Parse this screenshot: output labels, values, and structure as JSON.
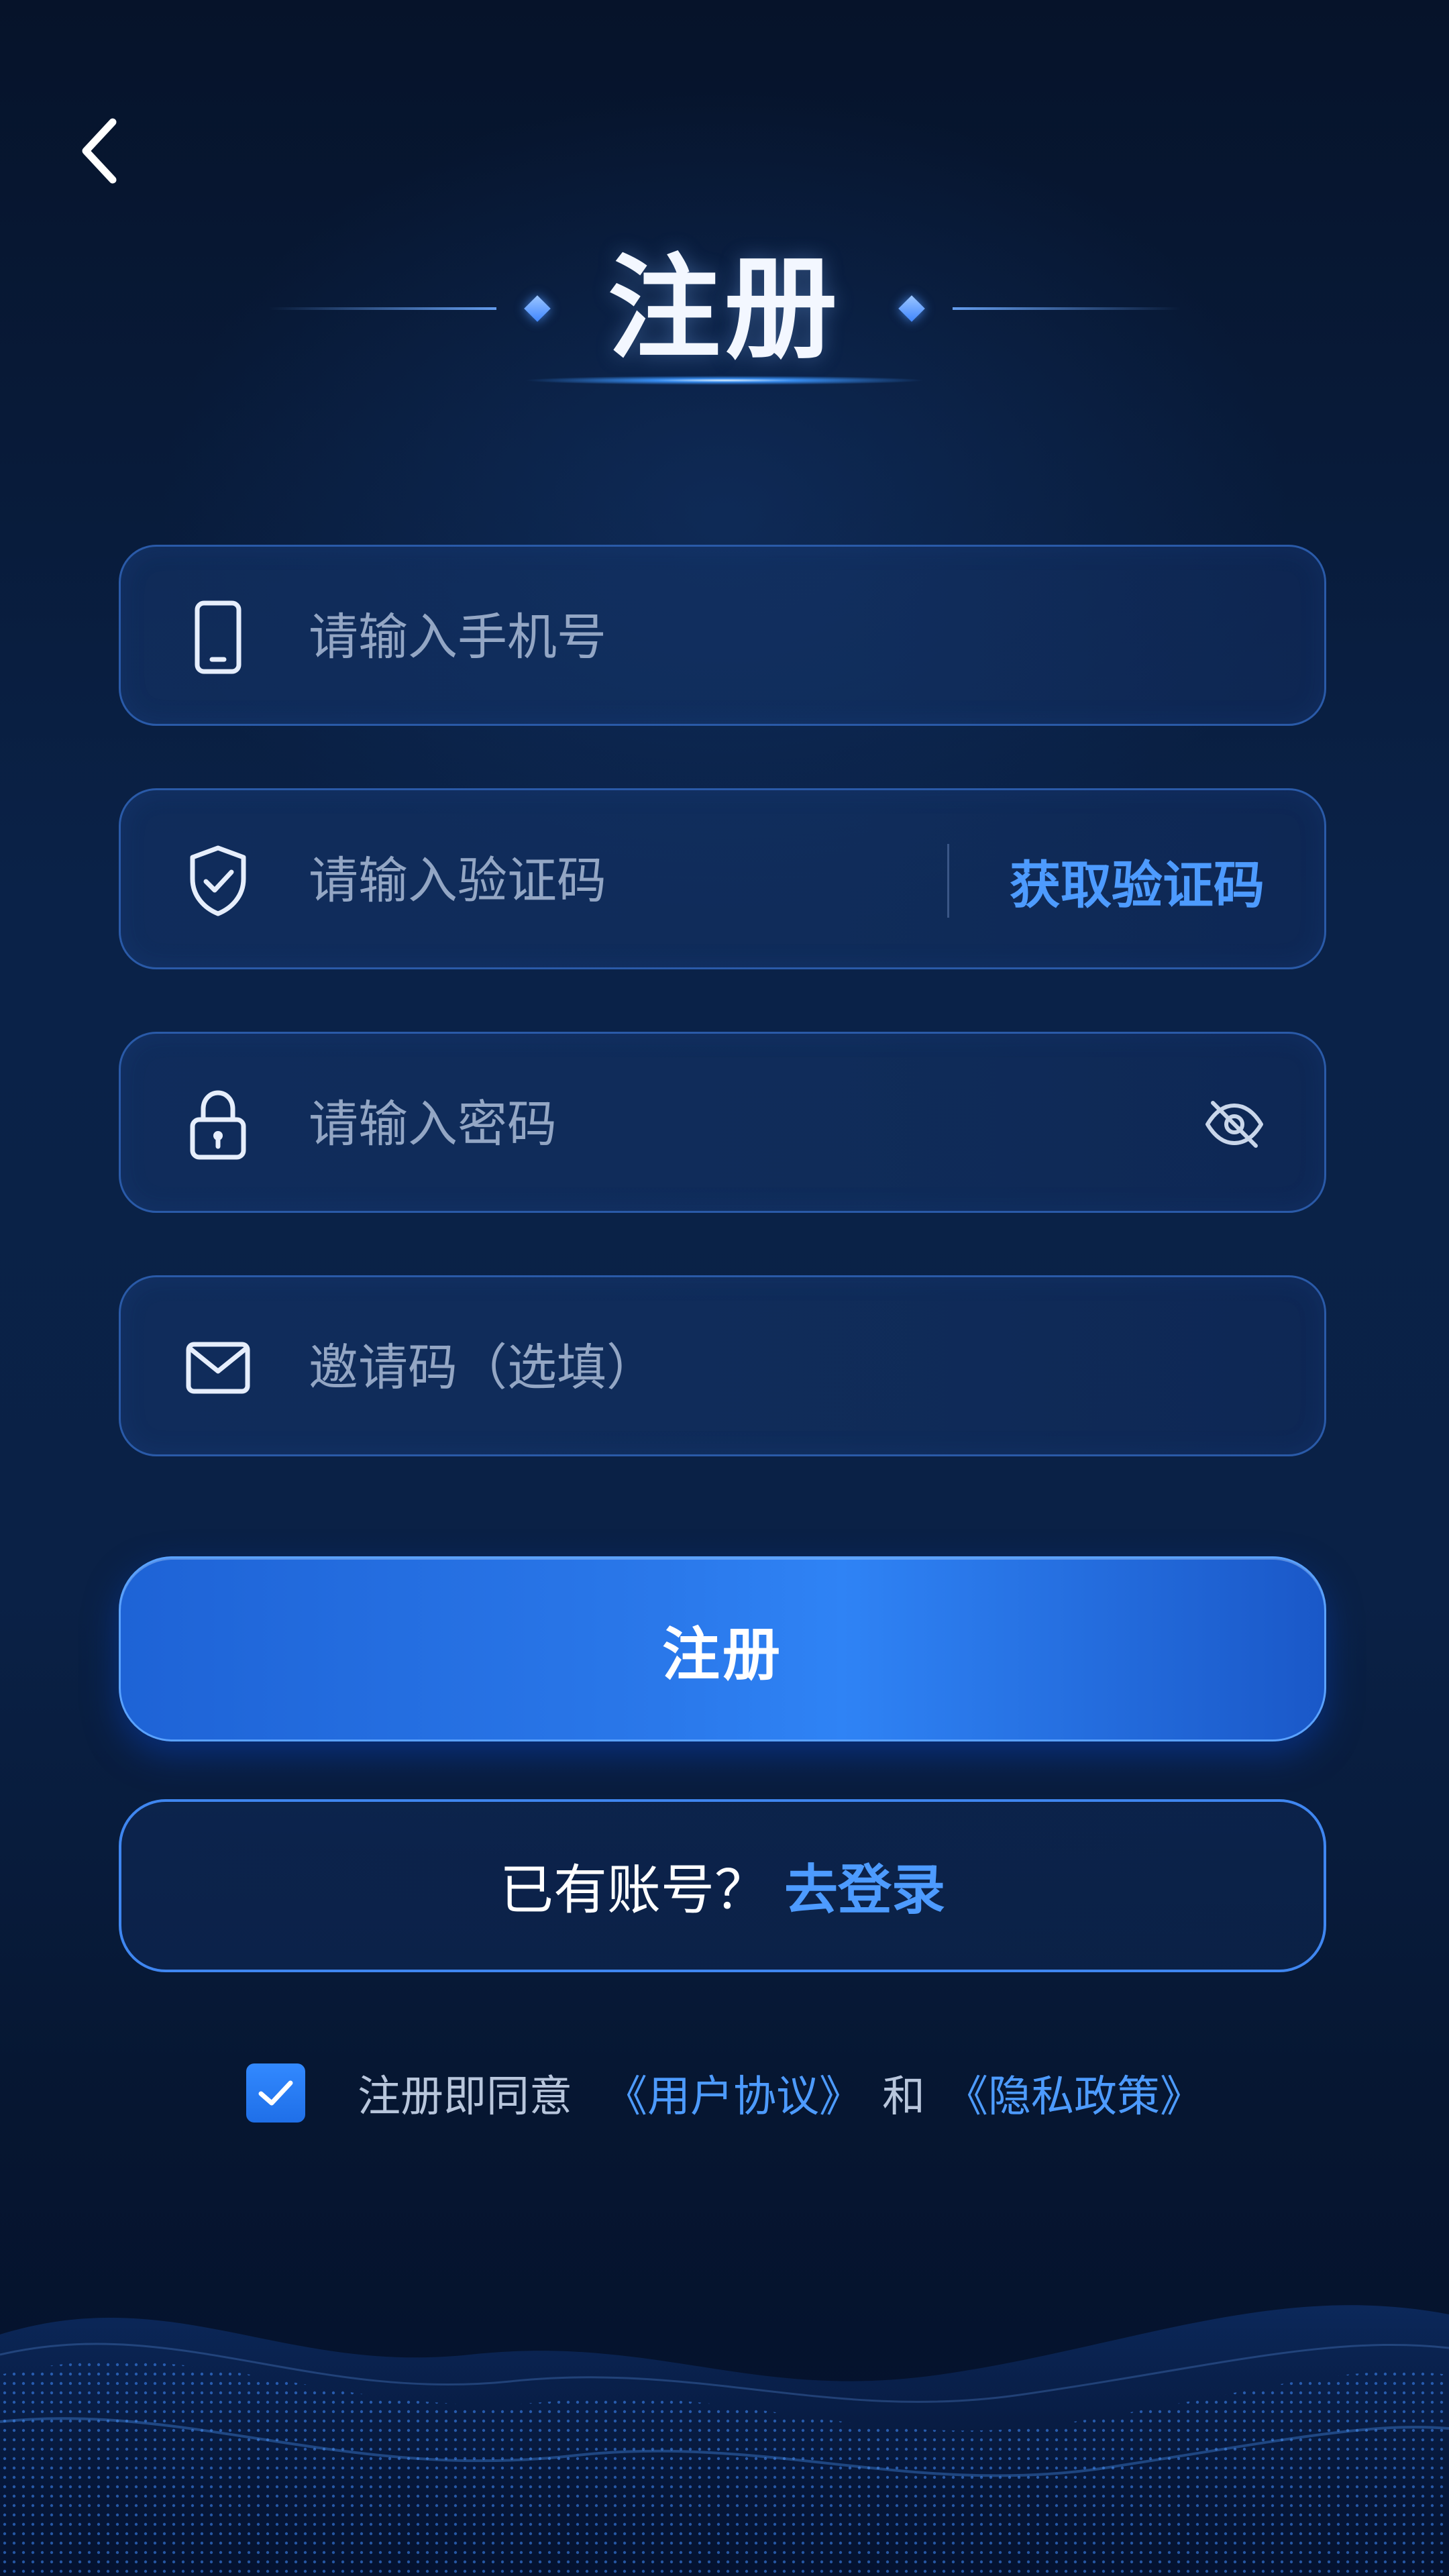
{
  "header": {
    "title": "注册"
  },
  "form": {
    "phone_placeholder": "请输入手机号",
    "code_placeholder": "请输入验证码",
    "get_code_label": "获取验证码",
    "password_placeholder": "请输入密码",
    "invite_placeholder": "邀请码（选填）"
  },
  "actions": {
    "register_label": "注册",
    "login_question": "已有账号？",
    "login_link": "去登录"
  },
  "agreement": {
    "checked": true,
    "prefix": "注册即同意",
    "user_agreement": "《用户协议》",
    "conjunction": "和",
    "privacy_policy": "《隐私政策》"
  },
  "icons": {
    "back": "chevron-left-icon",
    "phone": "phone-icon",
    "code": "shield-check-icon",
    "password": "lock-icon",
    "password_visibility": "eye-off-icon",
    "invite": "mail-icon",
    "checkbox": "check-icon"
  },
  "theme": {
    "background": "#0a2146",
    "accent": "#4d9bff",
    "button": "#2a78ea",
    "field_border": "#2a5aa8",
    "placeholder": "#93a6c4"
  }
}
